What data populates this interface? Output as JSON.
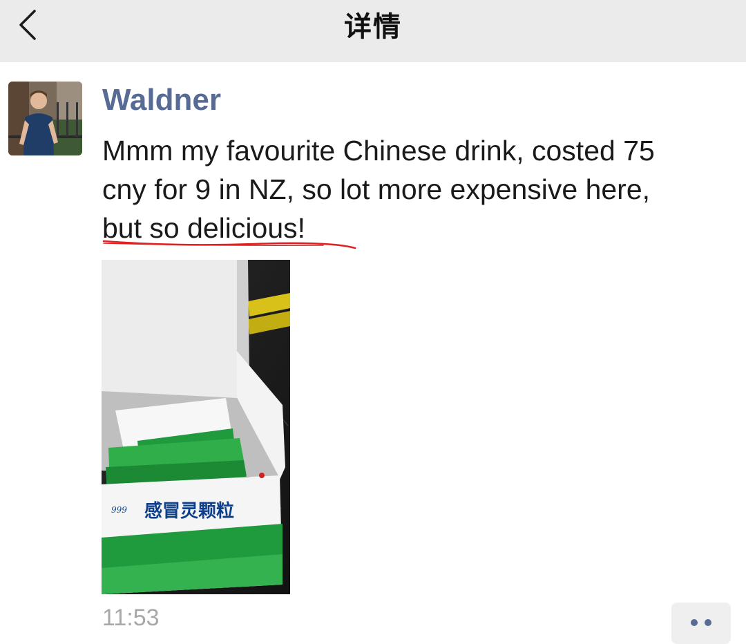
{
  "header": {
    "title": "详情",
    "back_icon": "chevron-left-icon",
    "background_color": "#ebebeb"
  },
  "post": {
    "author": "Waldner",
    "author_color": "#576b95",
    "text_lines": [
      "Mmm my favourite Chinese drink, costed 75",
      "cny for 9 in NZ, so lot more expensive here,",
      "but so delicious!"
    ],
    "highlight_color": "#e02020",
    "photo": {
      "box_label": "感冒灵颗粒",
      "brand_mark": "999",
      "accent_color": "#1f9a3c"
    },
    "time": "11:53",
    "more_icon": "more-dots-icon",
    "more_dot_color": "#576b95"
  }
}
